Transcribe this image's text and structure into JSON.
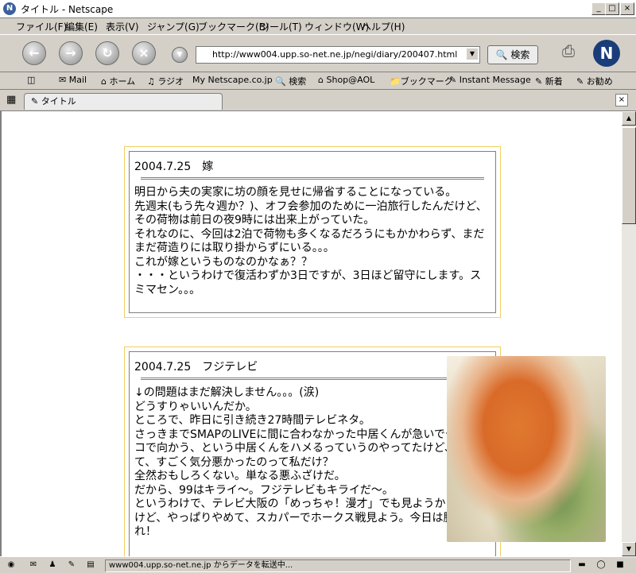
{
  "window": {
    "title": "タイトル - Netscape",
    "min": "_",
    "max": "□",
    "close": "×"
  },
  "menu": [
    "ファイル(F)",
    "編集(E)",
    "表示(V)",
    "ジャンプ(G)",
    "ブックマーク(B)",
    "ツール(T)",
    "ウィンドウ(W)",
    "ヘルプ(H)"
  ],
  "nav": {
    "url": "http://www004.upp.so-net.ne.jp/negi/diary/200407.html",
    "search_label": "検索"
  },
  "personal": [
    "Mail",
    "ホーム",
    "ラジオ",
    "Netscape.co.jp",
    "検索",
    "Shop@AOL",
    "ブックマーク",
    "Instant Message",
    "新着",
    "お勧め"
  ],
  "tab": {
    "label": "タイトル",
    "close": "×"
  },
  "entries": [
    {
      "title": "2004.7.25　嫁",
      "body": "明日から夫の実家に坊の顔を見せに帰省することになっている。\n先週末(もう先々週か？)、オフ会参加のために一泊旅行したんだけど、その荷物は前日の夜9時には出来上がっていた。\nそれなのに、今回は2泊で荷物も多くなるだろうにもかかわらず、まだまだ荷造りには取り掛からずにいる。。。\nこれが嫁というものなのかなぁ？？\n・・・というわけで復活わずか3日ですが、3日ほど留守にします。スミマセン。。。"
    },
    {
      "title": "2004.7.25　フジテレビ",
      "body": "↓の問題はまだ解決しません。。。(涙)\nどうすりゃいいんだか。\nところで、昨日に引き続き27時間テレビネタ。\nさっきまでSMAPのLIVEに間に合わなかった中居くんが急いでチャリンコで向かう、という中居くんをハメるっていうのやってたけど、あれ見て、すごく気分悪かったのって私だけ？\n全然おもしろくない。単なる悪ふざけだ。\nだから、99はキライ～。フジテレビもキライだ～。\nというわけで、テレビ大阪の「めっちゃ！漫才」でも見ようかと思ったけど、やっぱりやめて、スカパーでホークス戦見よう。今日は勝ってくれ！"
    }
  ],
  "status": {
    "text": "www004.upp.so-net.ne.jp からデータを転送中..."
  }
}
